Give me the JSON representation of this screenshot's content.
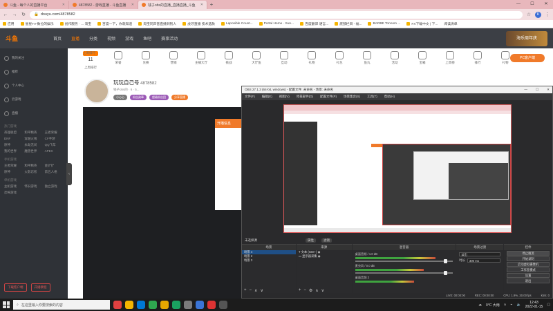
{
  "browser": {
    "tabs": [
      {
        "label": "斗鱼 - 每个人的直播平台",
        "active": false
      },
      {
        "label": "4878582 - 游戏直播 - 斗鱼直播",
        "active": false
      },
      {
        "label": "钱子obs的直播_直播直播_斗鱼",
        "active": true
      }
    ],
    "url": "douyu.com/4878582",
    "profile_initial": "K",
    "bookmarks": [
      "应用",
      "星星TV-数位的娱乐",
      "创作服务 · ... 淘宝",
      "百度一下，你就知道",
      "淘宝同声音直播到别人",
      "虎牙直播 技术选款",
      "Laposible Count...",
      "Portal Home · Sun...",
      "百度翻译 语言...",
      "底部栏目 - 福...",
      "BARBE Tonnom ...",
      "FX下载中文 | 下...",
      "阅读清单"
    ]
  },
  "douyu": {
    "logo": "斗鱼",
    "nav": [
      "首页",
      "直播",
      "分类",
      "视频",
      "游戏",
      "鱼吧",
      "赛事活动"
    ],
    "active_nav": "直播",
    "banner": "海乐周年庆",
    "categories": [
      "上周排行",
      "荣誉",
      "兑换",
      "营销",
      "主播大厅",
      "挑战",
      "大厅鱼",
      "互动",
      "礼物",
      "礼包",
      "鱼丸",
      "活动",
      "宝箱",
      "上周榜",
      "排行",
      "礼物"
    ],
    "rank_num": "11",
    "rank_badge": "上周排行",
    "pc_button": "PC客户端",
    "streamer": {
      "name": "玩玩自己号",
      "room_id": "4878582",
      "meta": "钱子obs的 · 6 · 5...",
      "tags": [
        "小心心",
        "粉丝勋章",
        "超级粉丝团",
        "分享直播"
      ]
    },
    "popup_title": "开播信息"
  },
  "sidebar": {
    "items": [
      "我的关注",
      "推荐",
      "个人中心",
      "云游戏",
      "直播"
    ],
    "section_hot": "热门游戏",
    "hot_games": [
      "英雄联盟",
      "和平精英",
      "王者荣耀",
      "DNF",
      "穿越火线",
      "CF手游",
      "原神",
      "永劫无间",
      "QQ飞车",
      "我的世界",
      "魔兽世界",
      "APEX"
    ],
    "section_mobile": "手机游戏",
    "mobile_games": [
      "王者荣耀",
      "和平精英",
      "金铲铲",
      "原神",
      "火影忍者",
      "第五人格"
    ],
    "section_single": "单机游戏",
    "single_games": [
      "主机游戏",
      "怀旧游戏",
      "独立游戏",
      "恐怖游戏"
    ],
    "bottom_buttons": [
      "下载客户端",
      "开播教程"
    ]
  },
  "obs": {
    "title": "OBS 27.1.3 (64-bit, windows) - 配置文件: 未命名 - 场景: 未命名",
    "menu": [
      "文件(F)",
      "编辑(E)",
      "视图(V)",
      "停靠部件(D)",
      "配置文件(P)",
      "场景集合(S)",
      "工具(T)",
      "帮助(H)"
    ],
    "source_bar_left": "未选择源",
    "source_bar_buttons": [
      "属性",
      "滤镜"
    ],
    "docks": {
      "scenes": {
        "title": "场景",
        "items": [
          "场景 4",
          "场景 2",
          "场景 3"
        ],
        "selected": 0
      },
      "sources": {
        "title": "来源",
        "items": [
          "文本 (GDI+)",
          "显示器采集"
        ]
      },
      "mixer": {
        "title": "混音器",
        "channels": [
          {
            "name": "桌面音频 / 1.0 dB",
            "level": 0.82
          },
          {
            "name": "麦克风 / 0.0 dB",
            "level": 0.7
          },
          {
            "name": "桌面音频 2",
            "level": 0.6
          }
        ]
      },
      "transitions": {
        "title": "场景过渡",
        "type": "淡出",
        "duration_label": "时长",
        "duration": "300 ms"
      },
      "controls": {
        "title": "控件",
        "buttons": [
          "停止推流",
          "开始录制",
          "启动虚拟摄像机",
          "工作室模式",
          "设置",
          "退出"
        ]
      }
    },
    "status": {
      "live": "LIVE: 00:00:00",
      "rec": "REC: 00:00:00",
      "cpu": "CPU: 1.9%, 30.00 fps",
      "kbps": "kb/s: 0"
    }
  },
  "taskbar": {
    "search_placeholder": "在这里输入你要搜索的内容",
    "weather": "0°C 大雨",
    "time": "12:43",
    "date": "2022-01-15",
    "icon_colors": [
      "#e04040",
      "#f4b400",
      "#0078d4",
      "#2fa84f",
      "#e6a700",
      "#1aa260",
      "#7b7b7b",
      "#3a74d6",
      "#d33",
      "#555"
    ]
  }
}
